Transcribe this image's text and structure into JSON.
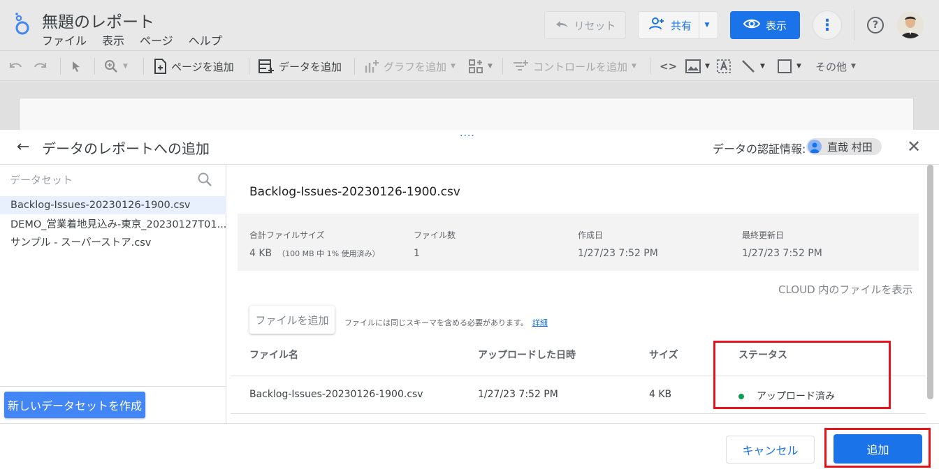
{
  "header": {
    "title": "無題のレポート",
    "menu": [
      "ファイル",
      "表示",
      "ページ",
      "ヘルプ"
    ],
    "reset_label": "リセット",
    "share_label": "共有",
    "view_label": "表示",
    "help_label": "?"
  },
  "toolbar": {
    "add_page": "ページを追加",
    "add_data": "データを追加",
    "add_chart": "グラフを追加",
    "add_control": "コントロールを追加",
    "code_label": "<>",
    "other": "その他"
  },
  "panel": {
    "title": "データのレポートへの追加",
    "cred_label": "データの認証情報:",
    "cred_user": "直哉 村田",
    "drag_handle": "····"
  },
  "datasets": {
    "label": "データセット",
    "items": [
      "Backlog-Issues-20230126-1900.csv",
      "DEMO_営業着地見込み-東京_20230127T01...",
      "サンプル - スーパーストア.csv"
    ],
    "new_button": "新しいデータセットを作成"
  },
  "file": {
    "name": "Backlog-Issues-20230126-1900.csv",
    "stats": {
      "total_size_label": "合計ファイルサイズ",
      "total_size_value": "4 KB",
      "total_size_note": "（100 MB 中 1% 使用済み）",
      "count_label": "ファイル数",
      "count_value": "1",
      "created_label": "作成日",
      "created_value": "1/27/23 7:52 PM",
      "updated_label": "最終更新日",
      "updated_value": "1/27/23 7:52 PM"
    },
    "cloud_link": "CLOUD 内のファイルを表示",
    "add_file_button": "ファイルを追加",
    "add_note": "ファイルには同じスキーマを含める必要があります。",
    "detail_link": "詳細"
  },
  "table": {
    "headers": [
      "ファイル名",
      "アップロードした日時",
      "サイズ",
      "ステータス"
    ],
    "rows": [
      {
        "name": "Backlog-Issues-20230126-1900.csv",
        "uploaded": "1/27/23 7:52 PM",
        "size": "4 KB",
        "status": "アップロード済み"
      }
    ]
  },
  "footer": {
    "cancel": "キャンセル",
    "add": "追加"
  },
  "colors": {
    "accent": "#1a73e8",
    "highlight": "#e8141c",
    "status_ok": "#0f9d58"
  }
}
